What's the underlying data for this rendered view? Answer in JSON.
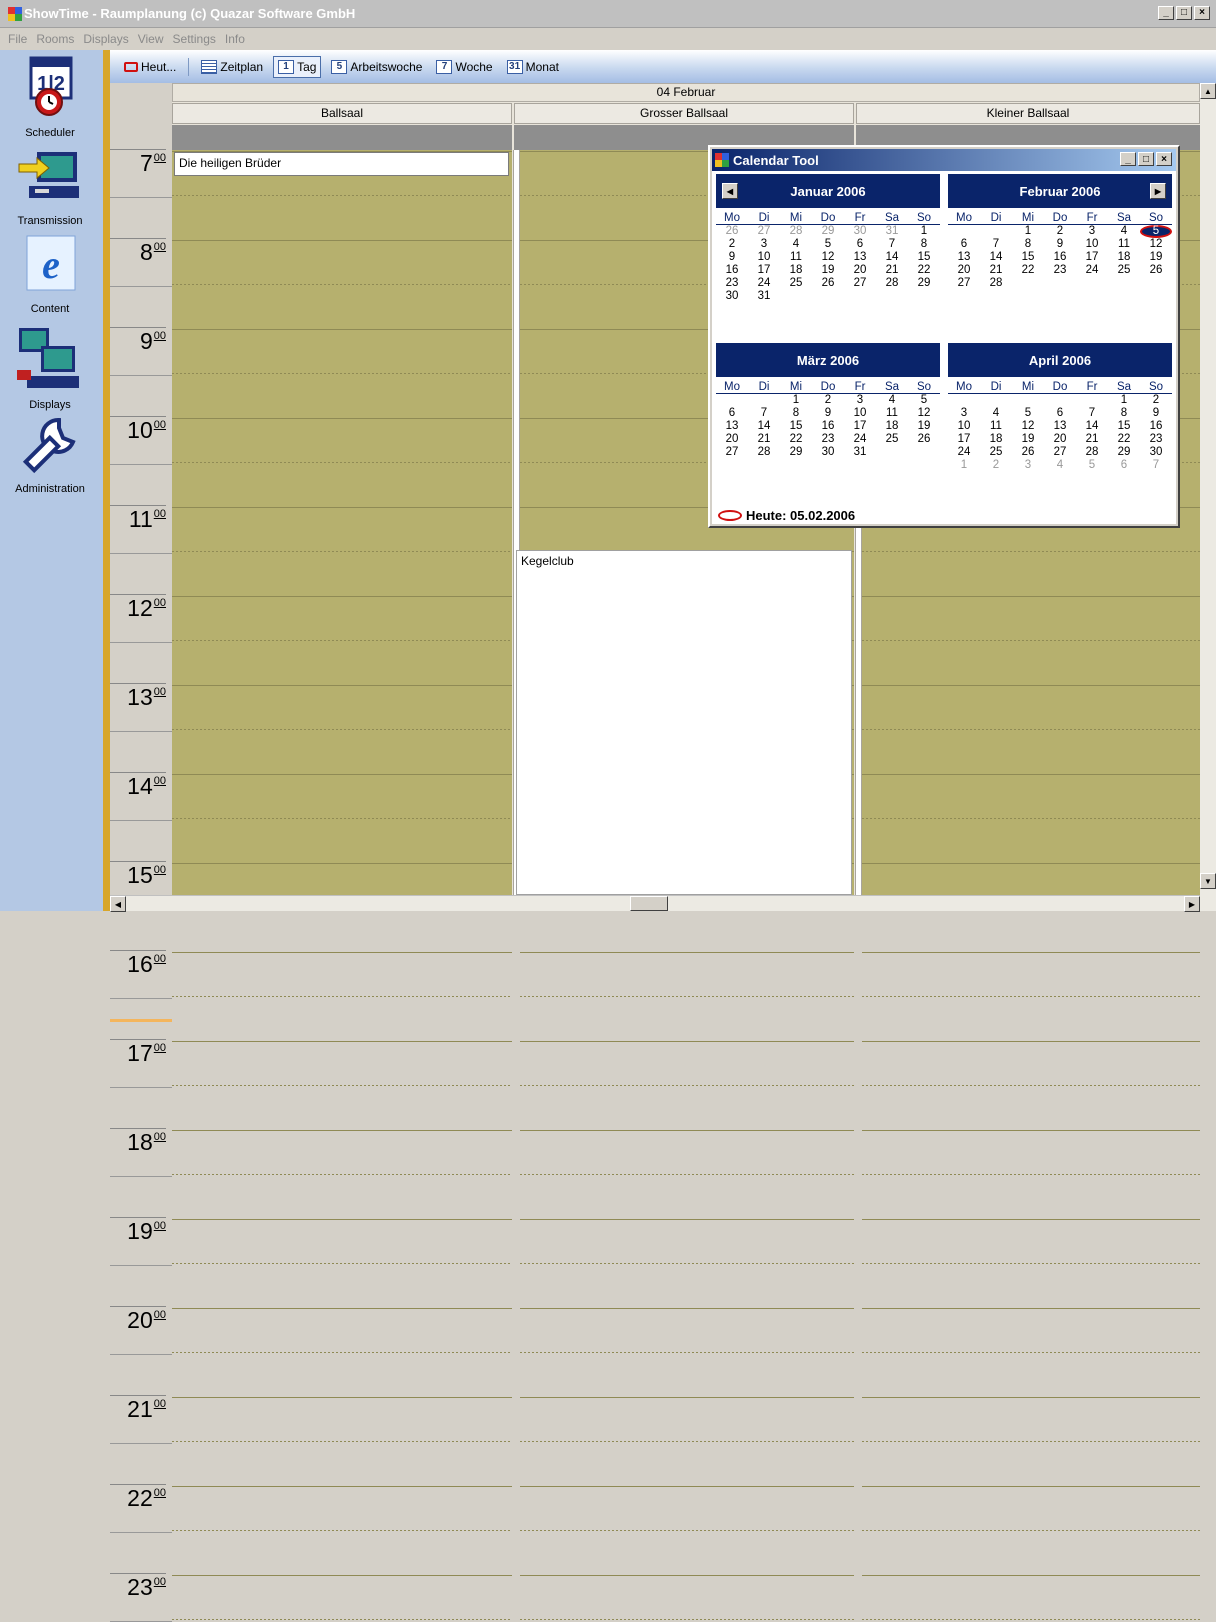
{
  "window": {
    "title": "ShowTime - Raumplanung (c) Quazar Software GmbH",
    "controls": [
      "_",
      "□",
      "×"
    ]
  },
  "menu": [
    "File",
    "Rooms",
    "Displays",
    "View",
    "Settings",
    "Info"
  ],
  "sidebar": {
    "items": [
      {
        "label": "Scheduler",
        "icon": "scheduler-icon"
      },
      {
        "label": "Transmission",
        "icon": "transmission-icon"
      },
      {
        "label": "Content",
        "icon": "content-icon"
      },
      {
        "label": "Displays",
        "icon": "displays-icon"
      },
      {
        "label": "Administration",
        "icon": "administration-icon"
      }
    ]
  },
  "toolbar": {
    "today": "Heut...",
    "schedule": "Zeitplan",
    "day": {
      "num": "1",
      "label": "Tag"
    },
    "workweek": {
      "num": "5",
      "label": "Arbeitswoche"
    },
    "week": {
      "num": "7",
      "label": "Woche"
    },
    "month": {
      "num": "31",
      "label": "Monat"
    }
  },
  "calendar": {
    "date_header": "04 Februar",
    "rooms": [
      "Ballsaal",
      "Grosser Ballsaal",
      "Kleiner Ballsaal"
    ],
    "hours": [
      "7",
      "8",
      "9",
      "10",
      "11",
      "12",
      "13",
      "14",
      "15",
      "16",
      "17",
      "18",
      "19",
      "20",
      "21",
      "22",
      "23"
    ],
    "minutes": "00",
    "events": [
      {
        "title": "Die heiligen Brüder",
        "room": "Ballsaal"
      },
      {
        "title": "Kegelclub",
        "room": "Grosser Ballsaal"
      }
    ]
  },
  "calendar_tool": {
    "title": "Calendar Tool",
    "weekday_headers": [
      "Mo",
      "Di",
      "Mi",
      "Do",
      "Fr",
      "Sa",
      "So"
    ],
    "months": [
      {
        "name": "Januar 2006",
        "nav": "prev",
        "days": [
          "26",
          "27",
          "28",
          "29",
          "30",
          "31",
          "1",
          "2",
          "3",
          "4",
          "5",
          "6",
          "7",
          "8",
          "9",
          "10",
          "11",
          "12",
          "13",
          "14",
          "15",
          "16",
          "17",
          "18",
          "19",
          "20",
          "21",
          "22",
          "23",
          "24",
          "25",
          "26",
          "27",
          "28",
          "29",
          "30",
          "31"
        ],
        "grey_leading": 6,
        "grey_trailing": 0
      },
      {
        "name": "Februar 2006",
        "nav": "next",
        "days": [
          "",
          "",
          "1",
          "2",
          "3",
          "4",
          "5",
          "6",
          "7",
          "8",
          "9",
          "10",
          "11",
          "12",
          "13",
          "14",
          "15",
          "16",
          "17",
          "18",
          "19",
          "20",
          "21",
          "22",
          "23",
          "24",
          "25",
          "26",
          "27",
          "28"
        ],
        "grey_leading": 0,
        "grey_trailing": 0,
        "today": "5"
      },
      {
        "name": "März 2006",
        "nav": "",
        "days": [
          "",
          "",
          "1",
          "2",
          "3",
          "4",
          "5",
          "6",
          "7",
          "8",
          "9",
          "10",
          "11",
          "12",
          "13",
          "14",
          "15",
          "16",
          "17",
          "18",
          "19",
          "20",
          "21",
          "22",
          "23",
          "24",
          "25",
          "26",
          "27",
          "28",
          "29",
          "30",
          "31"
        ],
        "grey_leading": 0,
        "grey_trailing": 0
      },
      {
        "name": "April 2006",
        "nav": "",
        "days": [
          "",
          "",
          "",
          "",
          "",
          "1",
          "2",
          "3",
          "4",
          "5",
          "6",
          "7",
          "8",
          "9",
          "10",
          "11",
          "12",
          "13",
          "14",
          "15",
          "16",
          "17",
          "18",
          "19",
          "20",
          "21",
          "22",
          "23",
          "24",
          "25",
          "26",
          "27",
          "28",
          "29",
          "30",
          "1",
          "2",
          "3",
          "4",
          "5",
          "6",
          "7"
        ],
        "grey_leading": 0,
        "grey_trailing": 7
      }
    ],
    "today_label": "Heute: 05.02.2006"
  },
  "colors": {
    "slot": "#b6b06e",
    "accent": "#0a246a",
    "sidebar": "#b4c8e4",
    "strip": "#d8a62a"
  }
}
